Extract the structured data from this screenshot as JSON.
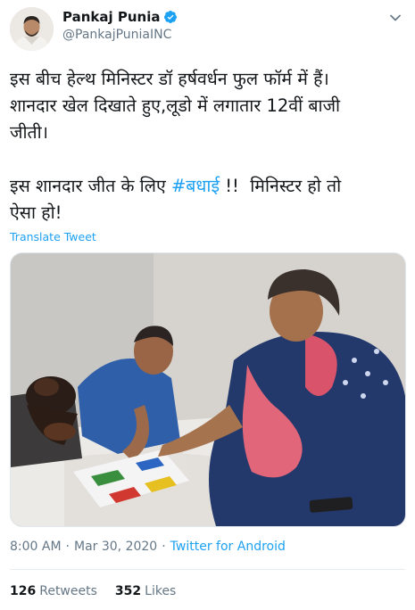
{
  "author": {
    "name": "Pankaj Punia",
    "handle": "@PankajPuniaINC",
    "verified": true
  },
  "tweet": {
    "line1": "इस बीच हेल्थ मिनिस्टर डॉ हर्षवर्धन फुल फॉर्म में हैं।\nशानदार खेल दिखाते हुए,लूडो में लगातार 12वीं बाजी\nजीती।\n\nइस शानदार जीत के लिए ",
    "hashtag": "#बधाई",
    "line2": " !!  मिनिस्टर हो तो\nऐसा हो!"
  },
  "translate_label": "Translate Tweet",
  "meta": {
    "time": "8:00 AM",
    "separator1": "·",
    "date": "Mar 30, 2020",
    "separator2": "·",
    "source": "Twitter for Android"
  },
  "stats": {
    "retweets_count": "126",
    "retweets_label": "Retweets",
    "likes_count": "352",
    "likes_label": "Likes"
  },
  "colors": {
    "accent": "#1da1f2",
    "text": "#14171a",
    "muted": "#657786"
  },
  "icons": [
    "verified-icon",
    "chevron-down-icon"
  ]
}
